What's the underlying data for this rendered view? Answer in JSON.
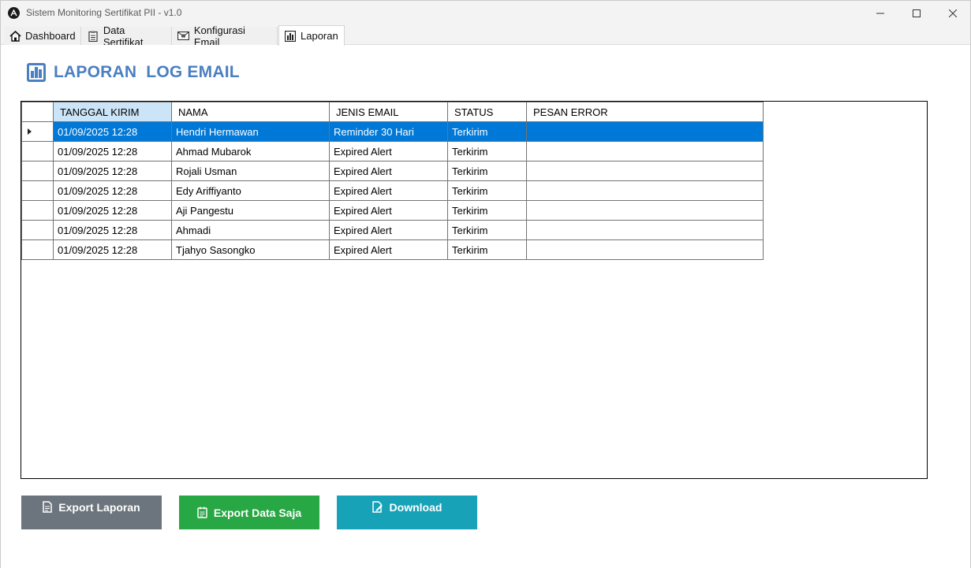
{
  "window": {
    "title": "Sistem Monitoring Sertifikat PII - v1.0"
  },
  "tabs": [
    {
      "label": "Dashboard",
      "icon": "house-icon"
    },
    {
      "label": "Data Sertifikat",
      "icon": "clipboard-icon"
    },
    {
      "label": "Konfigurasi Email",
      "icon": "envelope-icon"
    },
    {
      "label": "Laporan",
      "icon": "bar-chart-icon",
      "active": true
    }
  ],
  "page": {
    "title": "LAPORAN  LOG EMAIL",
    "title_color": "#4a7fc1"
  },
  "grid": {
    "columns": [
      "TANGGAL KIRIM",
      "NAMA",
      "JENIS EMAIL",
      "STATUS",
      "PESAN ERROR"
    ],
    "selected_column": 0,
    "selected_row": 0,
    "rows": [
      {
        "tanggal": "01/09/2025 12:28",
        "nama": "Hendri Hermawan",
        "jenis": "Reminder 30 Hari",
        "status": "Terkirim",
        "pesan": ""
      },
      {
        "tanggal": "01/09/2025 12:28",
        "nama": "Ahmad Mubarok",
        "jenis": "Expired Alert",
        "status": "Terkirim",
        "pesan": ""
      },
      {
        "tanggal": "01/09/2025 12:28",
        "nama": "Rojali Usman",
        "jenis": "Expired Alert",
        "status": "Terkirim",
        "pesan": ""
      },
      {
        "tanggal": "01/09/2025 12:28",
        "nama": "Edy Ariffiyanto",
        "jenis": "Expired Alert",
        "status": "Terkirim",
        "pesan": ""
      },
      {
        "tanggal": "01/09/2025 12:28",
        "nama": "Aji Pangestu",
        "jenis": "Expired Alert",
        "status": "Terkirim",
        "pesan": ""
      },
      {
        "tanggal": "01/09/2025 12:28",
        "nama": "Ahmadi",
        "jenis": "Expired Alert",
        "status": "Terkirim",
        "pesan": ""
      },
      {
        "tanggal": "01/09/2025 12:28",
        "nama": "Tjahyo Sasongko",
        "jenis": "Expired Alert",
        "status": "Terkirim",
        "pesan": ""
      }
    ],
    "selection_color": "#0078d7",
    "header_selected_color": "#cce4f7"
  },
  "buttons": {
    "export_laporan": {
      "label": "Export Laporan",
      "icon": "document-icon",
      "color": "#6c757d"
    },
    "export_data": {
      "label": "Export Data Saja",
      "icon": "notepad-icon",
      "color": "#28a745"
    },
    "download": {
      "label": "Download",
      "icon": "edit-document-icon",
      "color": "#17a2b8"
    }
  }
}
